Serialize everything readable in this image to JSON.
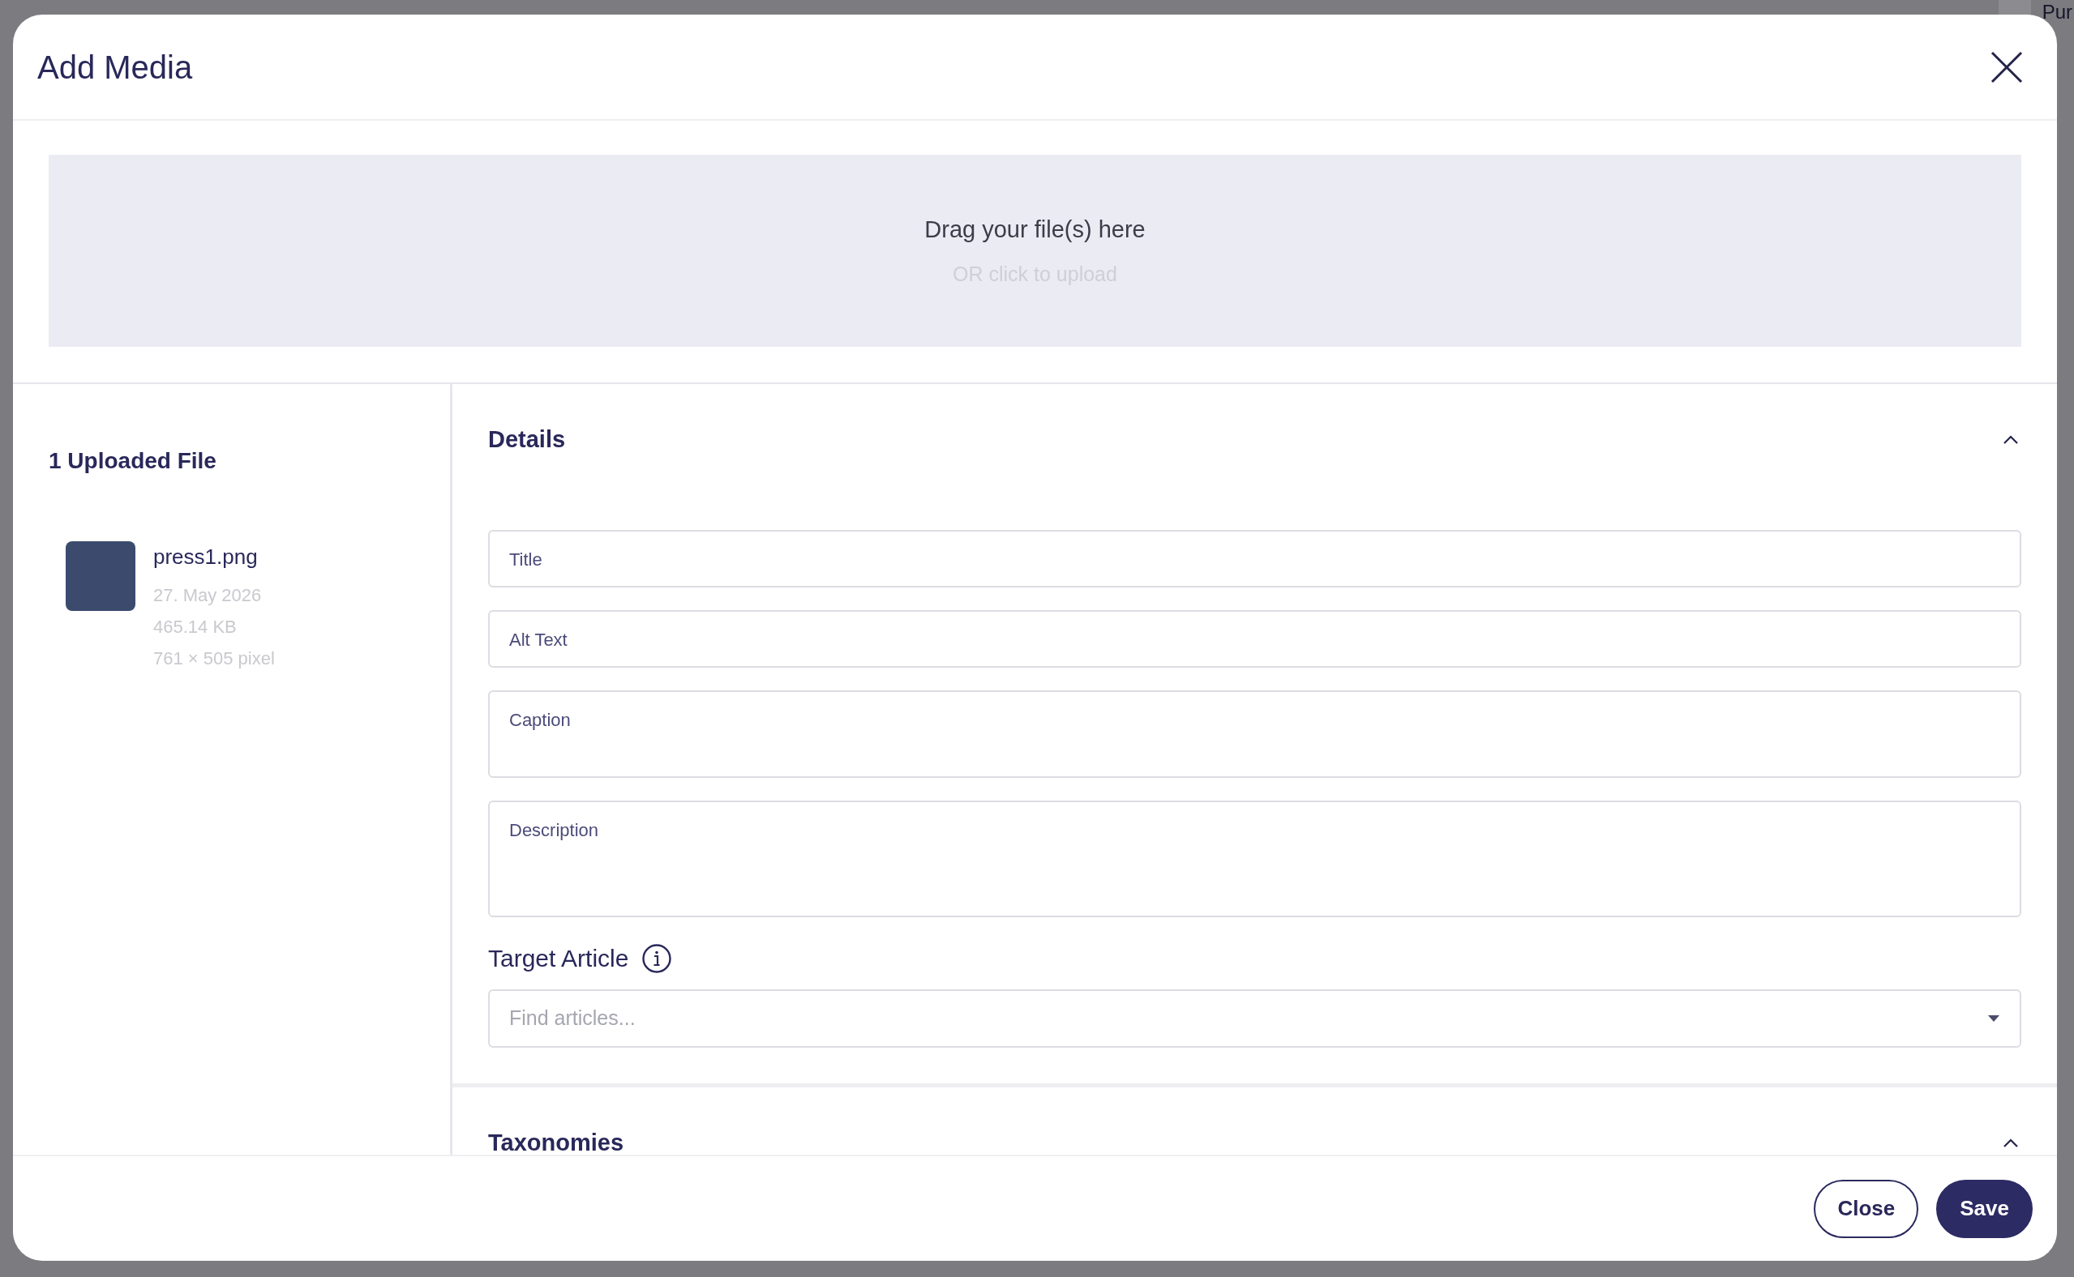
{
  "background_page": {
    "user_name": "Pur"
  },
  "dialog": {
    "title": "Add Media"
  },
  "dropzone": {
    "heading": "Drag your file(s) here",
    "hint": "OR click to upload"
  },
  "uploads": {
    "heading": "1 Uploaded File",
    "files": [
      {
        "name": "press1.png",
        "date": "27. May 2026",
        "size": "465.14 KB",
        "dimensions": "761 × 505 pixel"
      }
    ]
  },
  "sections": [
    {
      "title": "Details",
      "expanded": true,
      "fields": [
        {
          "kind": "input",
          "label": "Title"
        },
        {
          "kind": "input",
          "label": "Alt Text"
        },
        {
          "kind": "textarea",
          "label": "Caption"
        },
        {
          "kind": "textarea",
          "label": "Description"
        },
        {
          "kind": "select",
          "label": "Target Article",
          "placeholder": "Find articles..."
        }
      ]
    },
    {
      "title": "Taxonomies",
      "expanded": true
    }
  ],
  "footer_buttons": [
    {
      "label": "Close",
      "kind": "secondary"
    },
    {
      "label": "Save",
      "kind": "primary"
    }
  ]
}
